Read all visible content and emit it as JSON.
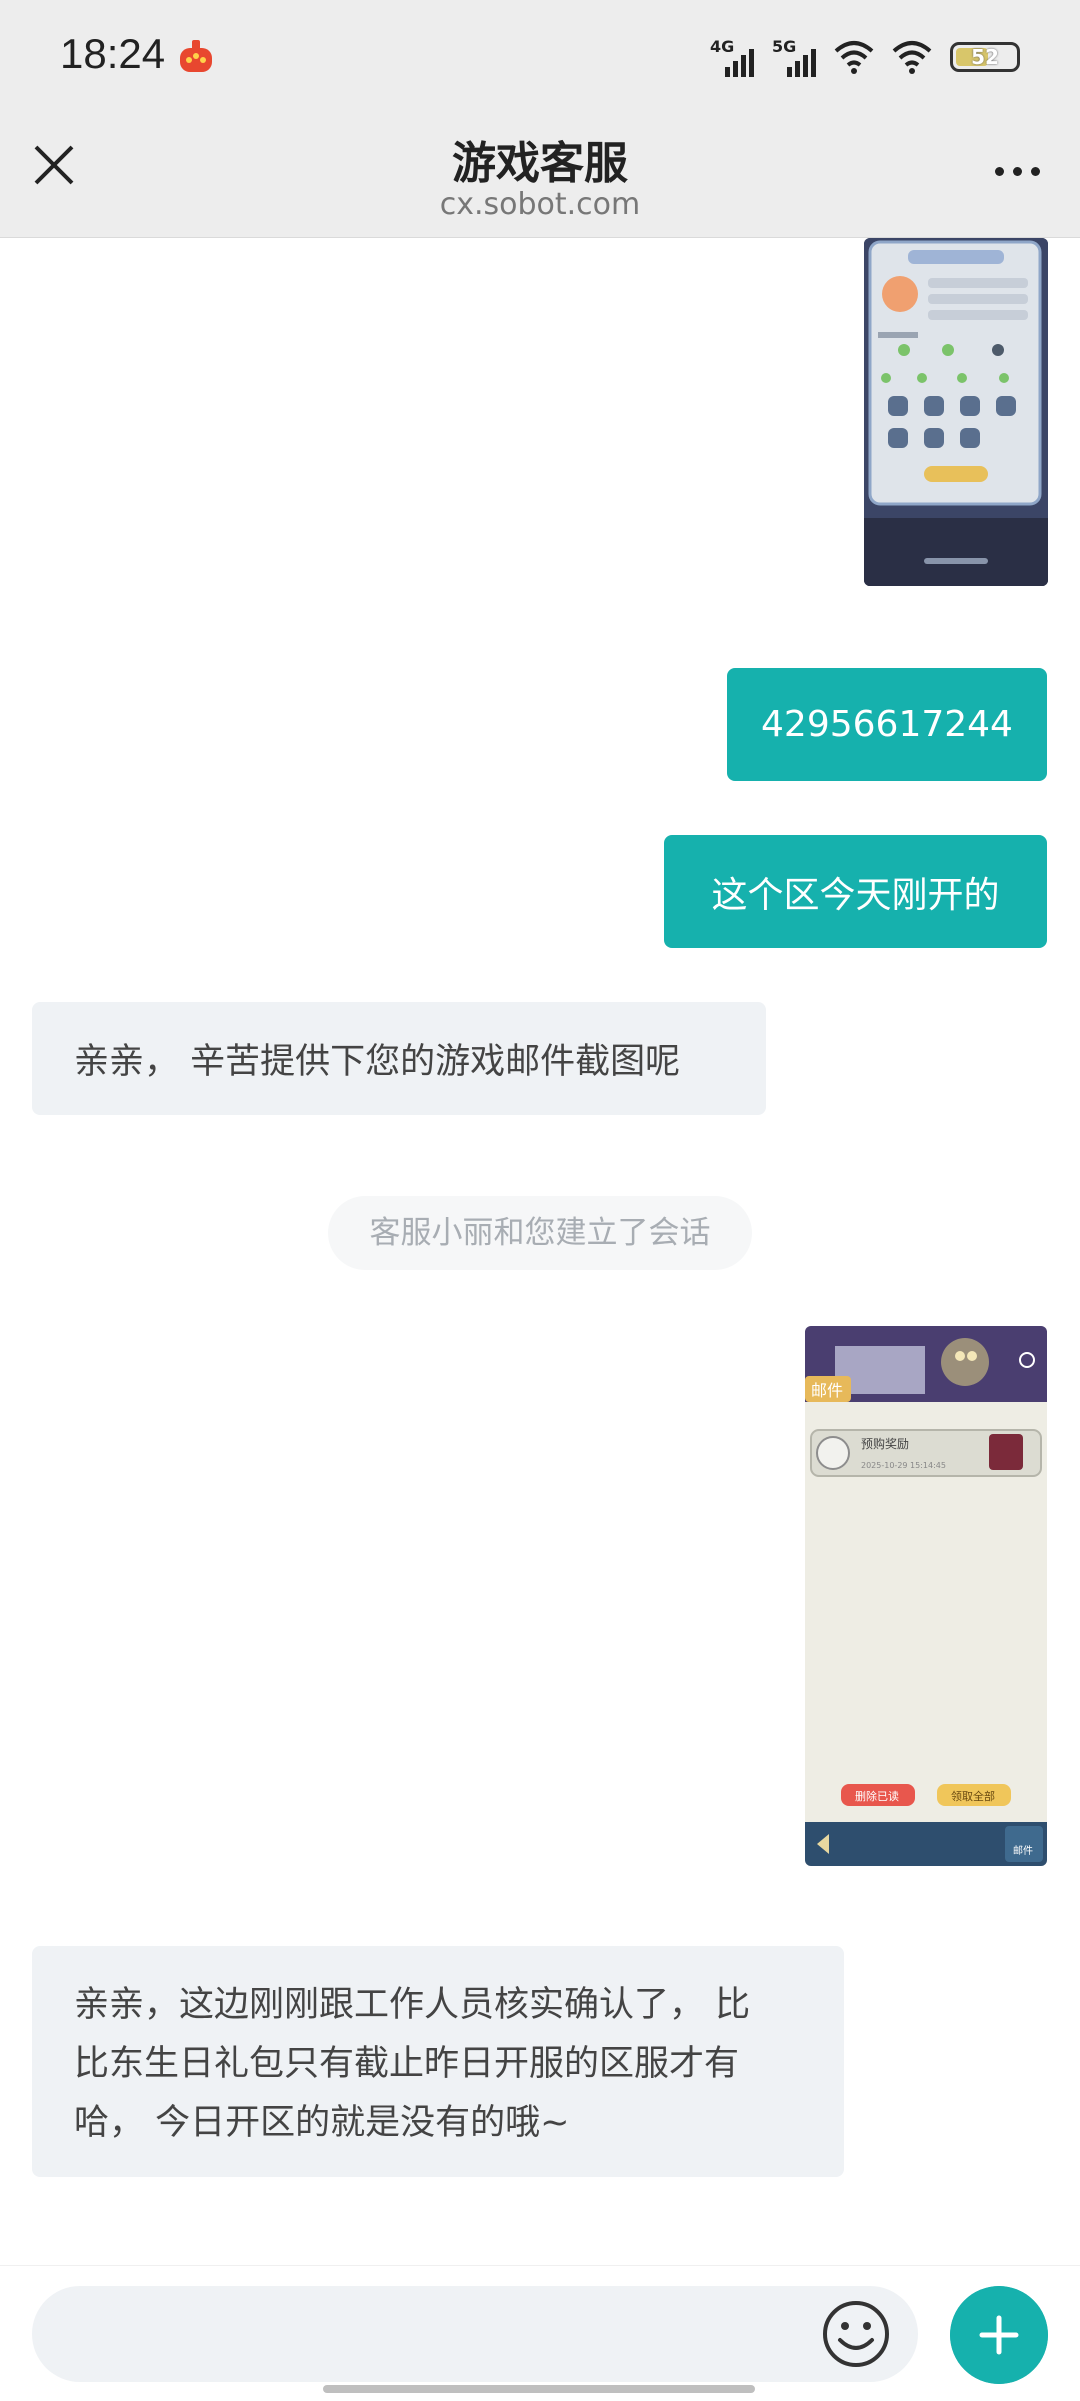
{
  "status_bar": {
    "time": "18:24",
    "network_1": "4G",
    "network_2": "5G",
    "battery": "52"
  },
  "header": {
    "title": "游戏客服",
    "subtitle": "cx.sobot.com"
  },
  "messages": {
    "m1": "42956617244",
    "m2": "这个区今天刚开的",
    "m3": "亲亲， 辛苦提供下您的游戏邮件截图呢",
    "system": "客服小丽和您建立了会话",
    "m4_line1": "亲亲，这边刚刚跟工作人员核实确认了， 比",
    "m4_line2": "比东生日礼包只有截止昨日开服的区服才有",
    "m4_line3": "哈， 今日开区的就是没有的哦~"
  },
  "screenshot_2": {
    "tag": "邮件",
    "mail_title": "预购奖励",
    "mail_date": "2025-10-29 15:14:45",
    "btn_delete": "删除已读",
    "btn_claim": "领取全部",
    "footer_label": "邮件"
  },
  "colors": {
    "accent": "#16b1ad",
    "agent_bubble": "#eff2f5",
    "bar_bg": "#ededed"
  }
}
